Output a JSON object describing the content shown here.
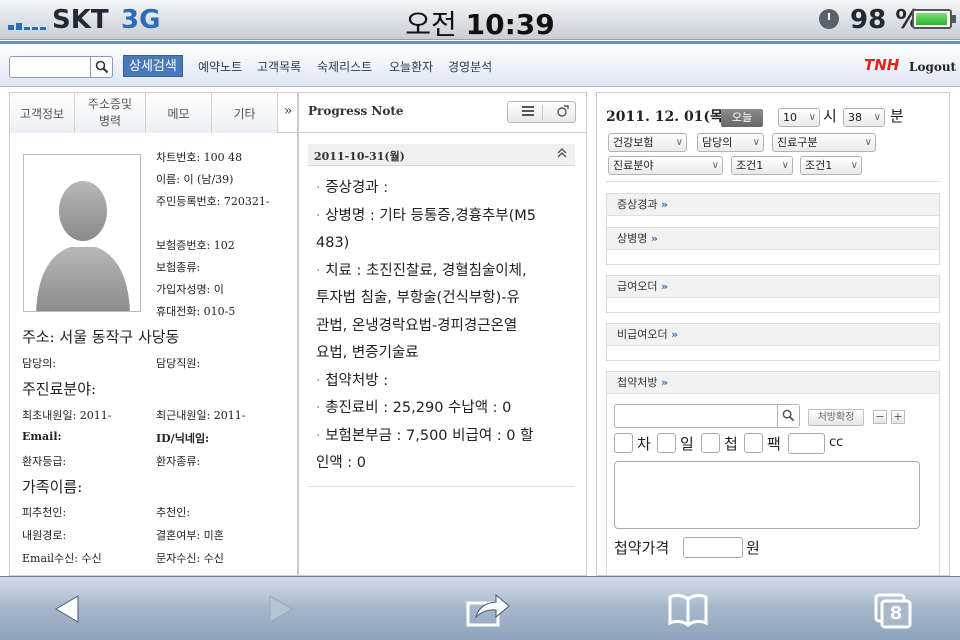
{
  "status_bar": {
    "carrier": "SKT",
    "network": "3G",
    "time_prefix": "오전",
    "time": "10:39",
    "battery": "98 %",
    "battery_level": 0.98
  },
  "nav": {
    "search_placeholder": "",
    "detail_search": "상세검색",
    "links": [
      "예약노트",
      "고객목록",
      "숙제리스트",
      "오늘환자",
      "경영분석"
    ],
    "brand": "TNH",
    "logout": "Logout"
  },
  "left": {
    "tabs": [
      {
        "line1": "고객정보",
        "line2": ""
      },
      {
        "line1": "주소증및",
        "line2": "병력"
      },
      {
        "line1": "메모",
        "line2": ""
      },
      {
        "line1": "기타",
        "line2": ""
      }
    ],
    "more": "»",
    "chart_no": "차트번호: 100      48",
    "name": "이름: 이       (남/39)",
    "resident_no": "주민등록번호: 720321-",
    "insurance_no": "보험증번호: 102",
    "insurance_type": "보험종류:",
    "subscriber": "가입자성명: 이",
    "mobile": "휴대전화: 010-5",
    "address": "주소: 서울 동작구 사당동",
    "doctor": "담당의:",
    "staff": "담당직원:",
    "main_field": "주진료분야:",
    "first_visit": "최초내원일: 2011-",
    "last_visit": "최근내원일: 2011-",
    "email": "Email:",
    "nickname": "ID/닉네임:",
    "grade": "환자등급:",
    "patient_type": "환자종류:",
    "family": "가족이름:",
    "referred_by": "피추천인:",
    "referrer": "추천인:",
    "visit_path": "내원경로:",
    "married": "결혼여부: 미혼",
    "email_recv": "Email수신: 수신",
    "sms_recv": "문자수신: 수신"
  },
  "progress": {
    "title": "Progress Note",
    "date": "2011-10-31(월)",
    "collapse": "≈",
    "lines": [
      "증상경과 :",
      "상병명 : 기타 등통증,경흉추부(M5",
      "483)",
      "치료 : 초진진찰료, 경혈침술이체,",
      "투자법 침술, 부항술(건식부항)-유",
      "관법, 온냉경락요법-경피경근온열",
      "요법, 변증기술료",
      "첩약처방 :",
      "총진료비 : 25,290   수납액 : 0",
      "보험본부금 : 7,500   비급여 : 0   할",
      "인액 : 0"
    ]
  },
  "right": {
    "date": "2011. 12. 01(목)",
    "today_btn": "오늘",
    "hour": "10",
    "hour_unit": "시",
    "minute": "38",
    "minute_unit": "분",
    "selects": [
      "건강보험",
      "담당의",
      "진료구분",
      "진료분야",
      "조건1",
      "조건1"
    ],
    "sections": [
      "증상경과",
      "상병명",
      "급여오더",
      "비급여오더"
    ],
    "rx_title": "첩약처방",
    "rx_confirm": "처방확정",
    "minus": "−",
    "plus": "+",
    "checks": [
      "차",
      "일",
      "첩",
      "팩"
    ],
    "cc": "cc",
    "price_label": "첩약가격",
    "price_unit": "원"
  },
  "toolbar": {
    "tabs_count": "8",
    "icons": [
      "back-arrow-icon",
      "forward-arrow-icon",
      "share-icon",
      "bookmarks-icon",
      "tabs-icon"
    ]
  }
}
